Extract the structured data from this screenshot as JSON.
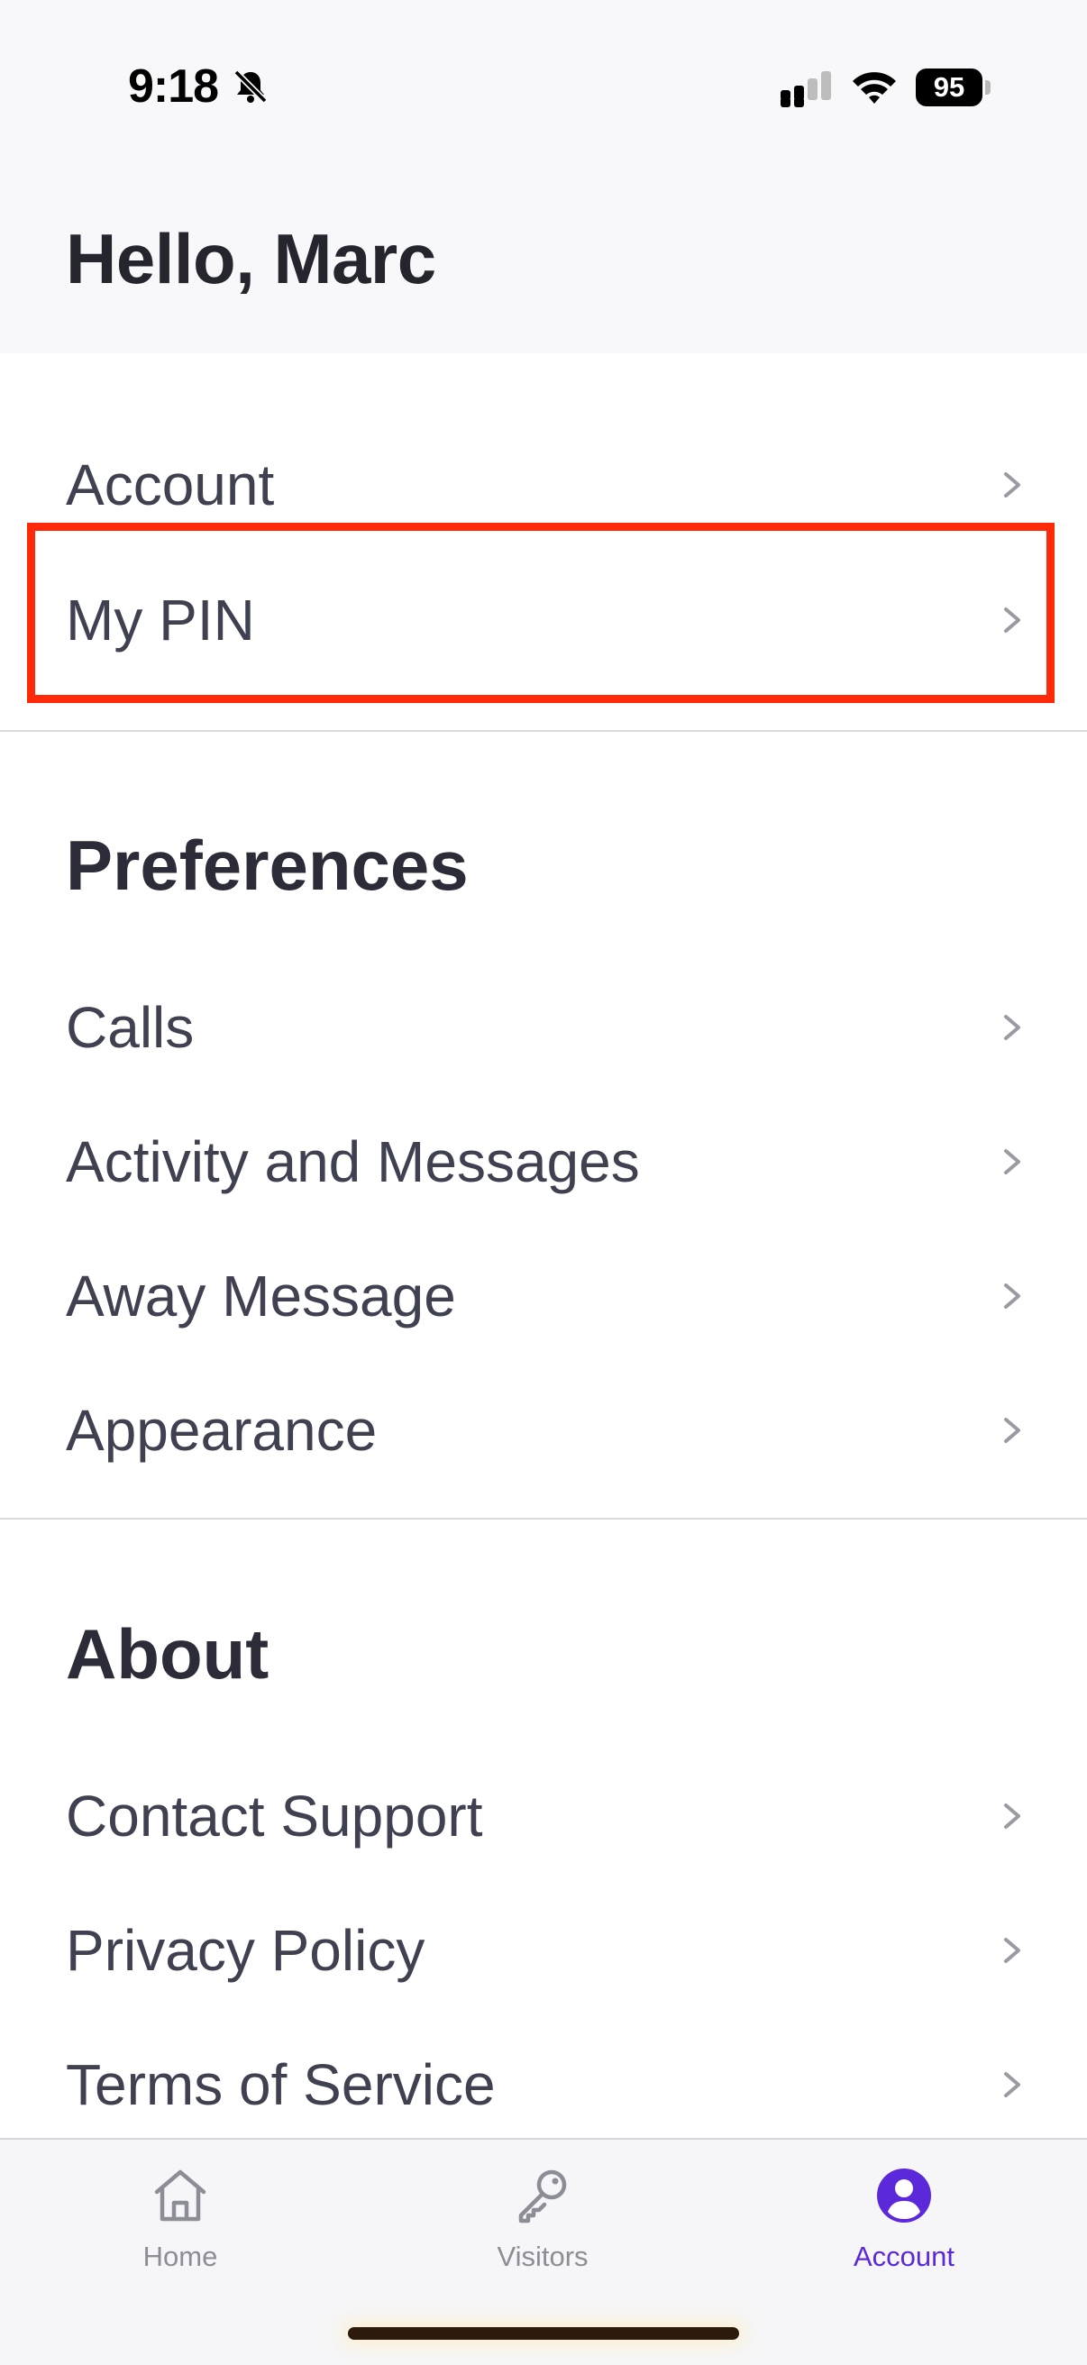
{
  "status_bar": {
    "time": "9:18",
    "battery": "95"
  },
  "header": {
    "greeting": "Hello, Marc"
  },
  "account_section": {
    "items": [
      {
        "label": "Account"
      },
      {
        "label": "My PIN"
      }
    ]
  },
  "preferences": {
    "title": "Preferences",
    "items": [
      {
        "label": "Calls"
      },
      {
        "label": "Activity and Messages"
      },
      {
        "label": "Away Message"
      },
      {
        "label": "Appearance"
      }
    ]
  },
  "about": {
    "title": "About",
    "items": [
      {
        "label": "Contact Support"
      },
      {
        "label": "Privacy Policy"
      },
      {
        "label": "Terms of Service"
      }
    ]
  },
  "tabbar": {
    "tabs": [
      {
        "label": "Home",
        "icon": "home-icon"
      },
      {
        "label": "Visitors",
        "icon": "key-icon"
      },
      {
        "label": "Account",
        "icon": "account-icon"
      }
    ],
    "active": "Account"
  },
  "colors": {
    "accent": "#5b29d9",
    "highlight": "#ff2a0a",
    "header_bg": "#f8f8fa",
    "text": "#3f4151"
  }
}
